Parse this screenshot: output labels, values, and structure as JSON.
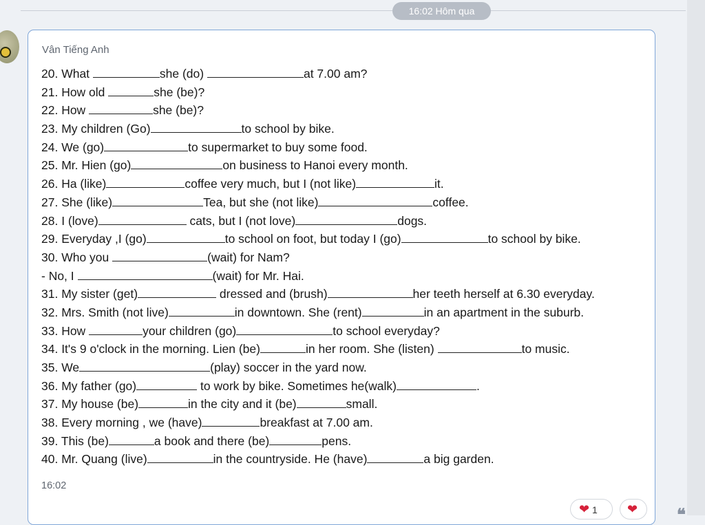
{
  "header": {
    "time_divider": "16:02 Hôm qua"
  },
  "message": {
    "sender": "Vân Tiếng Anh",
    "time": "16:02",
    "lines": [
      {
        "a": "20. What ",
        "b": "she (do) ",
        "c": "at 7.00 am?",
        "d": "",
        "e": ""
      },
      {
        "a": "21. How old ",
        "b": "she (be)?",
        "c": "",
        "d": "",
        "e": ""
      },
      {
        "a": "22. How ",
        "b": "she (be)?",
        "c": "",
        "d": "",
        "e": ""
      },
      {
        "a": "23. My children (Go)",
        "b": "to school by bike.",
        "c": "",
        "d": "",
        "e": ""
      },
      {
        "a": "24. We (go)",
        "b": "to supermarket to buy some food.",
        "c": "",
        "d": "",
        "e": ""
      },
      {
        "a": "25. Mr. Hien (go)",
        "b": "on business to Hanoi every month.",
        "c": "",
        "d": "",
        "e": ""
      },
      {
        "a": "26. Ha (like)",
        "b": "coffee very much, but I (not like)",
        "c": "it.",
        "d": "",
        "e": ""
      },
      {
        "a": "27. She (like)",
        "b": "Tea, but she (not like)",
        "c": "coffee.",
        "d": "",
        "e": ""
      },
      {
        "a": "28. I (love)",
        "b": " cats, but I (not love)",
        "c": "dogs.",
        "d": "",
        "e": ""
      },
      {
        "a": "29. Everyday ,I (go)",
        "b": "to school on foot, but today I (go)",
        "c": "to school by bike.",
        "d": "",
        "e": ""
      },
      {
        "a": "30. Who you ",
        "b": "(wait) for Nam?",
        "c": "",
        "d": "",
        "e": ""
      },
      {
        "a": "- No, I ",
        "b": "(wait) for Mr. Hai.",
        "c": "",
        "d": "",
        "e": ""
      },
      {
        "a": "31. My sister (get)",
        "b": " dressed and (brush)",
        "c": "her teeth herself at 6.30 everyday.",
        "d": "",
        "e": ""
      },
      {
        "a": "32. Mrs. Smith (not live)",
        "b": "in downtown. She (rent)",
        "c": "in an apartment in the suburb.",
        "d": "",
        "e": ""
      },
      {
        "a": "33. How ",
        "b": "your children (go)",
        "c": "to school everyday?",
        "d": "",
        "e": ""
      },
      {
        "a": "34. It's 9 o'clock in the morning. Lien (be)",
        "b": "in her room. She (listen) ",
        "c": "to music.",
        "d": "",
        "e": ""
      },
      {
        "a": "35. We",
        "b": "(play) soccer in the yard now.",
        "c": "",
        "d": "",
        "e": ""
      },
      {
        "a": "36. My father (go)",
        "b": " to work by bike. Sometimes he(walk)",
        "c": ".",
        "d": "",
        "e": ""
      },
      {
        "a": "37. My house (be)",
        "b": "in the city and it (be)",
        "c": "small.",
        "d": "",
        "e": ""
      },
      {
        "a": "38. Every morning , we (have)",
        "b": "breakfast at 7.00 am.",
        "c": "",
        "d": "",
        "e": ""
      },
      {
        "a": "39. This (be)",
        "b": "a book and there (be)",
        "c": "pens.",
        "d": "",
        "e": ""
      },
      {
        "a": "40. Mr. Quang (live)",
        "b": "in the countryside. He (have)",
        "c": "a big garden.",
        "d": "",
        "e": ""
      }
    ]
  },
  "reactions": [
    {
      "icon": "heart-icon",
      "count": "1"
    },
    {
      "icon": "heart-icon",
      "count": ""
    }
  ],
  "colors": {
    "bubble_border": "#7fa6d8",
    "heart": "#d6223a",
    "pill": "#b7bdc6"
  }
}
